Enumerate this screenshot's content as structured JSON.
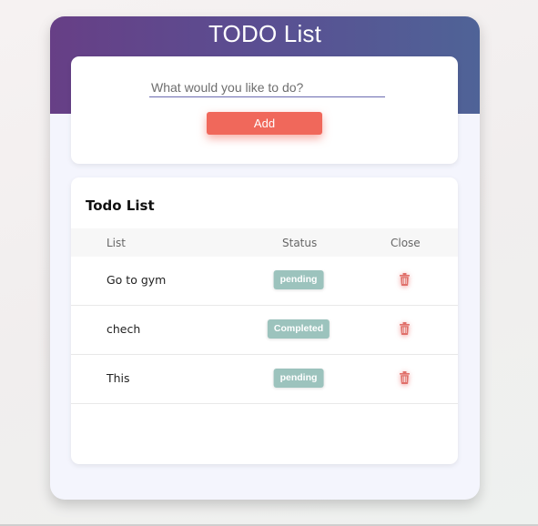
{
  "header": {
    "title": "TODO List"
  },
  "form": {
    "placeholder": "What would you like to do?",
    "value": "",
    "add_label": "Add"
  },
  "list": {
    "title": "Todo List",
    "columns": {
      "list": "List",
      "status": "Status",
      "close": "Close"
    },
    "items": [
      {
        "text": "Go to gym",
        "status": "pending",
        "delete_icon": "trash-icon"
      },
      {
        "text": "chech",
        "status": "Completed",
        "delete_icon": "trash-icon"
      },
      {
        "text": "This",
        "status": "pending",
        "delete_icon": "trash-icon"
      }
    ]
  },
  "colors": {
    "header_gradient_start": "#673f86",
    "header_gradient_end": "#4f6397",
    "add_button": "#f0685b",
    "status_badge": "#9cc3bd",
    "delete_icon": "#e0706a",
    "card_background": "#f4f5fd"
  }
}
